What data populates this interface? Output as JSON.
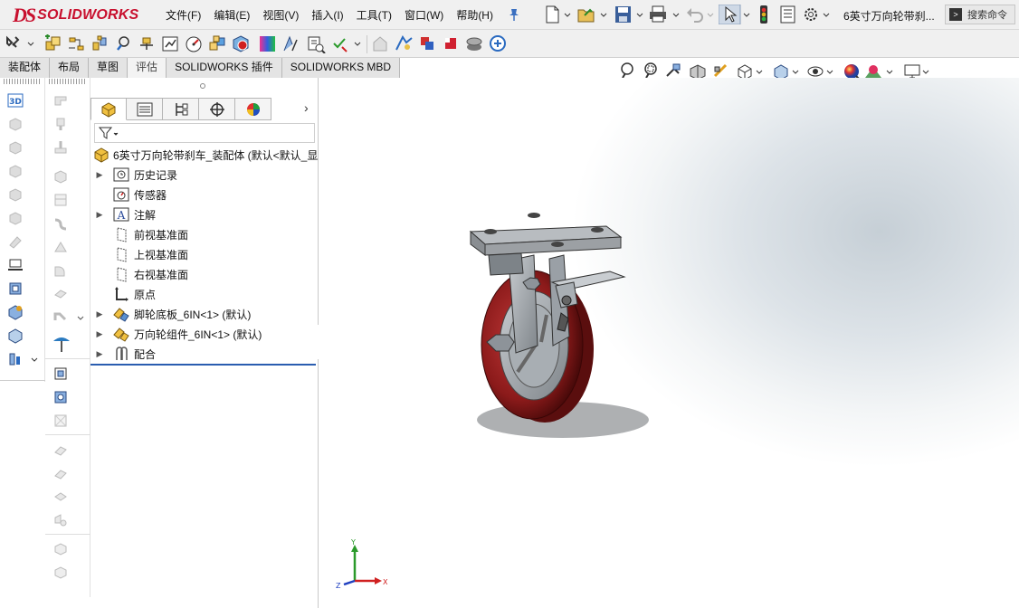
{
  "app": {
    "name": "SOLIDWORKS",
    "logo_prefix": "DS",
    "accent": "#c8102e"
  },
  "menu": [
    "文件(F)",
    "编辑(E)",
    "视图(V)",
    "插入(I)",
    "工具(T)",
    "窗口(W)",
    "帮助(H)"
  ],
  "document": {
    "title": "6英寸万向轮带刹..."
  },
  "search": {
    "placeholder": "搜索命令"
  },
  "tabs": [
    "装配体",
    "布局",
    "草图",
    "评估",
    "SOLIDWORKS 插件",
    "SOLIDWORKS MBD"
  ],
  "feature_tree": {
    "root": "6英寸万向轮带刹车_装配体 (默认<默认_显",
    "items": [
      {
        "label": "历史记录",
        "icon": "history-icon",
        "expandable": true
      },
      {
        "label": "传感器",
        "icon": "sensor-icon",
        "expandable": false
      },
      {
        "label": "注解",
        "icon": "annotation-icon",
        "expandable": true
      },
      {
        "label": "前视基准面",
        "icon": "plane-icon",
        "expandable": false
      },
      {
        "label": "上视基准面",
        "icon": "plane-icon",
        "expandable": false
      },
      {
        "label": "右视基准面",
        "icon": "plane-icon",
        "expandable": false
      },
      {
        "label": "原点",
        "icon": "origin-icon",
        "expandable": false
      },
      {
        "label": "脚轮底板_6IN<1> (默认)",
        "icon": "part-icon",
        "expandable": true
      },
      {
        "label": "万向轮组件_6IN<1> (默认)",
        "icon": "subassembly-icon",
        "expandable": true
      },
      {
        "label": "配合",
        "icon": "mates-icon",
        "expandable": true
      }
    ]
  },
  "triad": {
    "x": "X",
    "y": "Y",
    "z": "Z"
  },
  "colors": {
    "wheel_tread": "#8b1a1a",
    "hub_metal": "#9aa0a6",
    "axis_x": "#d02020",
    "axis_y": "#2a9a2a",
    "axis_z": "#2040c0"
  }
}
